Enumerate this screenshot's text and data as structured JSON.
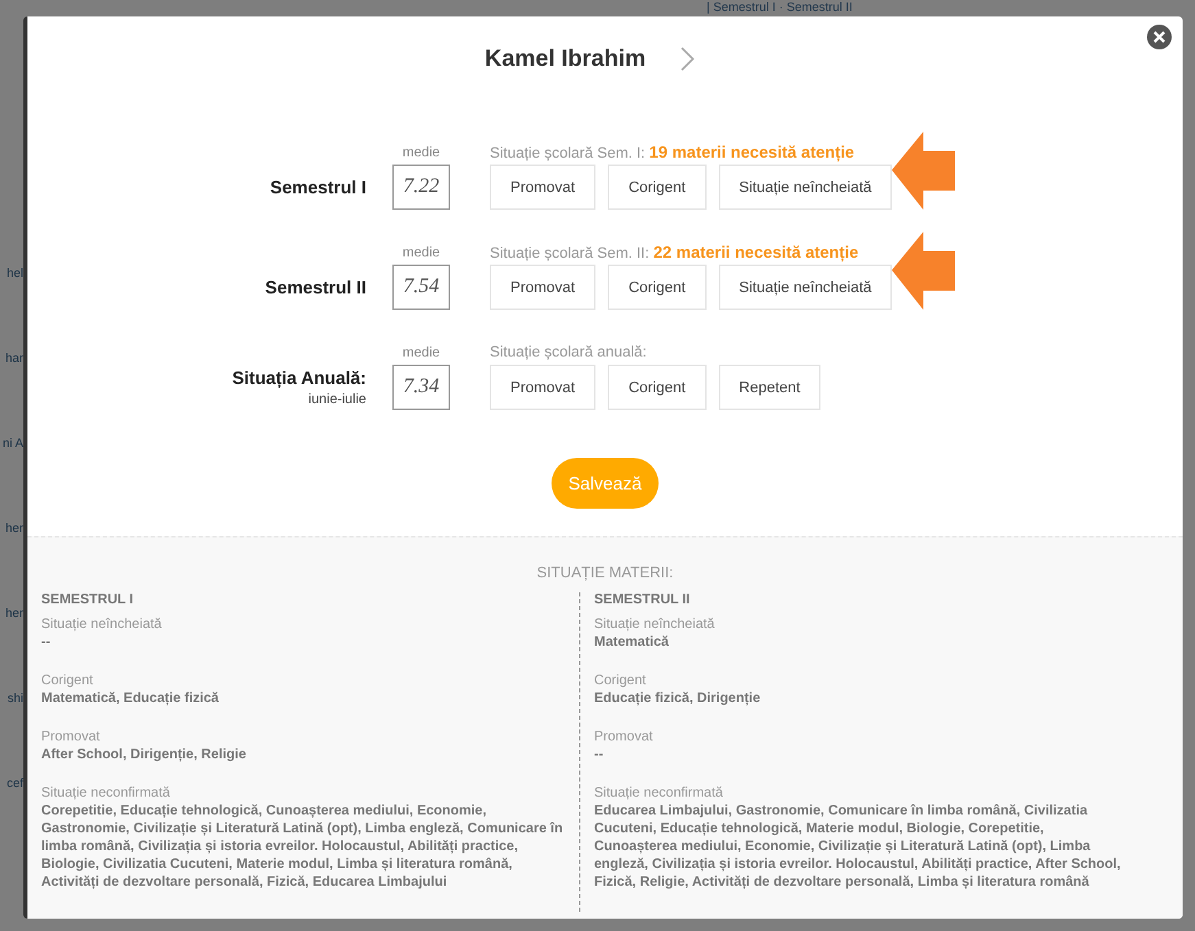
{
  "background": {
    "breadcrumb": "| Semestrul I · Semestrul II",
    "list_fragments": [
      "hel",
      "har",
      "ni A",
      "her",
      "her",
      "shi",
      "cef"
    ]
  },
  "modal": {
    "title": "Kamel Ibrahim",
    "terms": [
      {
        "label": "Semestrul I",
        "average_label": "medie",
        "average": "7.22",
        "status": "Situație școlară Sem. I: **19 materii necesită atenție**",
        "arrow": true,
        "options": [
          {
            "label": "Promovat",
            "selected": false
          },
          {
            "label": "Corigent",
            "selected": false
          },
          {
            "label": "Situație neîncheiată",
            "selected": false
          }
        ]
      },
      {
        "label": "Semestrul II",
        "average_label": "medie",
        "average": "7.54",
        "status": "Situație școlară Sem. II: **22 materii necesită atenție**",
        "arrow": true,
        "options": [
          {
            "label": "Promovat",
            "selected": false
          },
          {
            "label": "Corigent",
            "selected": false
          },
          {
            "label": "Situație neîncheiată",
            "selected": false
          }
        ]
      },
      {
        "label": "Situația Anuală:",
        "sublabel": "iunie-iulie",
        "average_label": "medie",
        "average": "7.34",
        "status": "Situație școlară anuală:",
        "arrow": false,
        "options": [
          {
            "label": "Promovat",
            "selected": false
          },
          {
            "label": "Corigent",
            "selected": false
          },
          {
            "label": "Repetent",
            "selected": false
          }
        ]
      }
    ],
    "save_button": "Salvează",
    "subjects": {
      "title": "SITUAȚIE MATERII:",
      "columns": [
        {
          "heading": "SEMESTRUL I",
          "groups": [
            {
              "label": "Situație neîncheiată",
              "value": "--"
            },
            {
              "label": "Corigent",
              "value": "Matematică, Educație fizică"
            },
            {
              "label": "Promovat",
              "value": "After School, Dirigenție, Religie"
            },
            {
              "label": "Situație neconfirmată",
              "value": "Corepetitie, Educație tehnologică, Cunoașterea mediului, Economie, Gastronomie, Civilizație și Literatură Latină (opt), Limba engleză, Comunicare în limba română, Civilizația și istoria evreilor. Holocaustul, Abilități practice, Biologie, Civilizatia Cucuteni, Materie modul, Limba și literatura română, Activități de dezvoltare personală, Fizică, Educarea Limbajului"
            }
          ]
        },
        {
          "heading": "SEMESTRUL II",
          "groups": [
            {
              "label": "Situație neîncheiată",
              "value": "Matematică"
            },
            {
              "label": "Corigent",
              "value": "Educație fizică, Dirigenție"
            },
            {
              "label": "Promovat",
              "value": "--"
            },
            {
              "label": "Situație neconfirmată",
              "value": "Educarea Limbajului, Gastronomie, Comunicare în limba română, Civilizatia Cucuteni, Educație tehnologică, Materie modul, Biologie, Corepetitie, Cunoașterea mediului, Economie, Civilizație și Literatură Latină (opt), Limba engleză, Civilizația și istoria evreilor. Holocaustul, Abilități practice, After School, Fizică, Religie, Activități de dezvoltare personală, Limba și literatura română"
            }
          ]
        }
      ]
    }
  }
}
